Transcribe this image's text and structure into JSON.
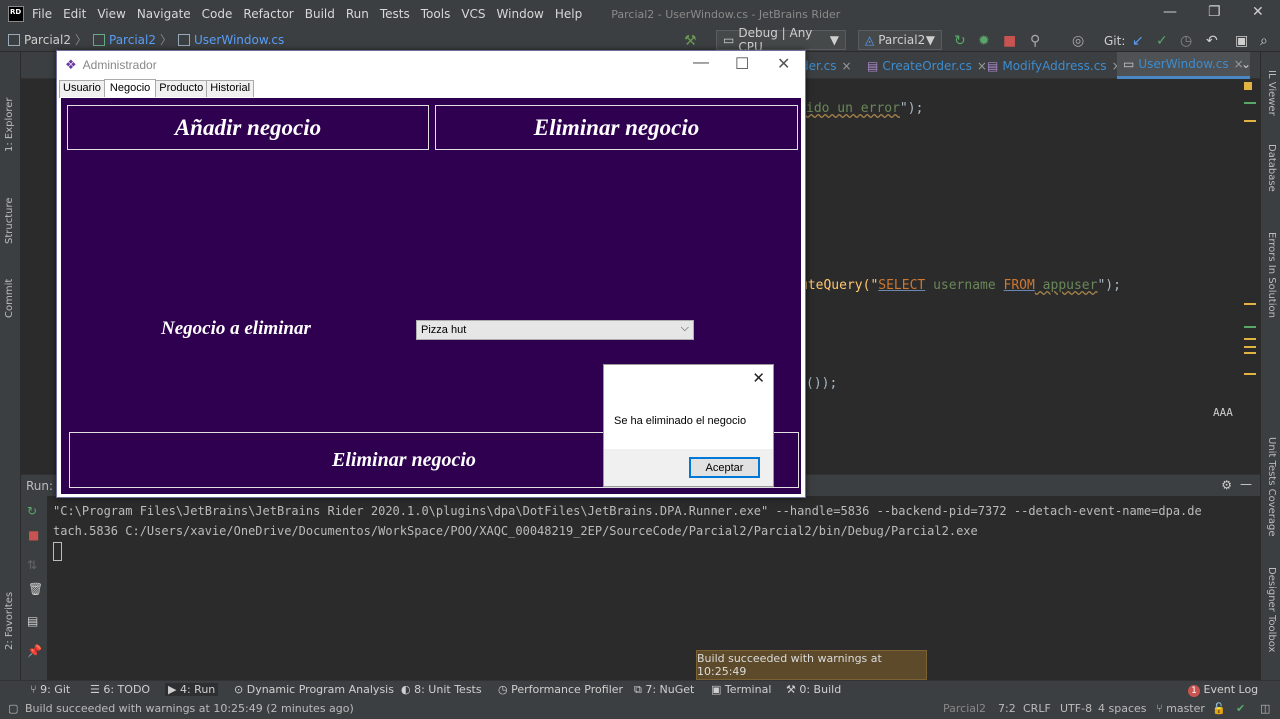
{
  "menubar": {
    "logo": "RD",
    "items": [
      "File",
      "Edit",
      "View",
      "Navigate",
      "Code",
      "Refactor",
      "Build",
      "Run",
      "Tests",
      "Tools",
      "VCS",
      "Window",
      "Help"
    ],
    "window_title": "Parcial2 - UserWindow.cs - JetBrains Rider",
    "minimize": "—",
    "restore": "❐",
    "close": "✕"
  },
  "navbar": {
    "crumbs": [
      "Parcial2",
      "Parcial2",
      "UserWindow.cs"
    ],
    "config": "Debug | Any CPU",
    "project": "Parcial2",
    "git_label": "Git:"
  },
  "editor_tabs": [
    {
      "label": "der.cs"
    },
    {
      "label": "CreateOrder.cs"
    },
    {
      "label": "ModifyAddress.cs"
    },
    {
      "label": "UserWindow.cs"
    }
  ],
  "editor": {
    "line1_string": "ido un error",
    "line1_end": "\");",
    "line2_prefix": "uteQuery(\"",
    "line2_kw1": "SELECT",
    "line2_mid1": " username ",
    "line2_kw2": "FROM",
    "line2_mid2": " appuser",
    "line2_end": "\");",
    "line3": "());"
  },
  "left_strip": {
    "explorer": "1: Explorer",
    "structure": "Structure",
    "commit": "Commit",
    "favorites": "2: Favorites"
  },
  "right_strip": {
    "il_viewer": "IL Viewer",
    "database": "Database",
    "errors": "Errors In Solution",
    "unit_tests": "Unit Tests Coverage",
    "designer": "Designer Toolbox"
  },
  "run_panel": {
    "title": "Run:",
    "console_line1": "\"C:\\Program Files\\JetBrains\\JetBrains Rider 2020.1.0\\plugins\\dpa\\DotFiles\\JetBrains.DPA.Runner.exe\" --handle=5836 --backend-pid=7372 --detach-event-name=dpa.de",
    "console_line2": "tach.5836 C:/Users/xavie/OneDrive/Documentos/WorkSpace/POO/XAQC_00048219_2EP/SourceCode/Parcial2/Parcial2/bin/Debug/Parcial2.exe"
  },
  "bottom_tools": {
    "git": "9: Git",
    "todo": "6: TODO",
    "run": "4: Run",
    "dpa": "Dynamic Program Analysis",
    "unit_tests": "8: Unit Tests",
    "profiler": "Performance Profiler",
    "nuget": "7: NuGet",
    "terminal": "Terminal",
    "build": "0: Build",
    "event_log": "Event Log",
    "event_count": "1"
  },
  "toast": "Build succeeded with warnings at 10:25:49",
  "statusbar": {
    "message": "Build succeeded with warnings at 10:25:49 (2 minutes ago)",
    "project": "Parcial2",
    "pos": "7:2",
    "eol": "CRLF",
    "encoding": "UTF-8",
    "indent": "4 spaces",
    "branch": "master"
  },
  "winform": {
    "title": "Administrador",
    "tabs": [
      "Usuario",
      "Negocio",
      "Producto",
      "Historial"
    ],
    "add_button": "Añadir negocio",
    "delete_top_button": "Eliminar negocio",
    "label": "Negocio a eliminar",
    "combo_value": "Pizza hut",
    "delete_bottom_button": "Eliminar negocio",
    "body_color": "#2f0050"
  },
  "msgbox": {
    "message": "Se ha eliminado el negocio",
    "ok": "Aceptar"
  }
}
